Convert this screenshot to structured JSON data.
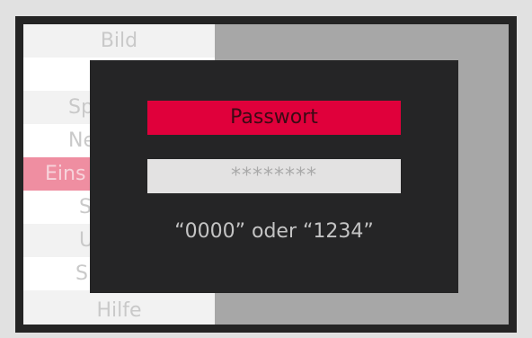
{
  "menu": {
    "items": [
      {
        "label": "Bild"
      },
      {
        "label": ""
      },
      {
        "label": "Sp"
      },
      {
        "label": "Ne"
      },
      {
        "label": "Eins"
      },
      {
        "label": "S"
      },
      {
        "label": "U"
      },
      {
        "label": "S"
      },
      {
        "label": "Hilfe"
      }
    ]
  },
  "dialog": {
    "title": "Passwort",
    "password_value": "********",
    "hint": "“0000” oder “1234”"
  },
  "colors": {
    "accent": "#e0003b",
    "dialog_bg": "#252526",
    "selected_menu": "#ef8ea1"
  }
}
